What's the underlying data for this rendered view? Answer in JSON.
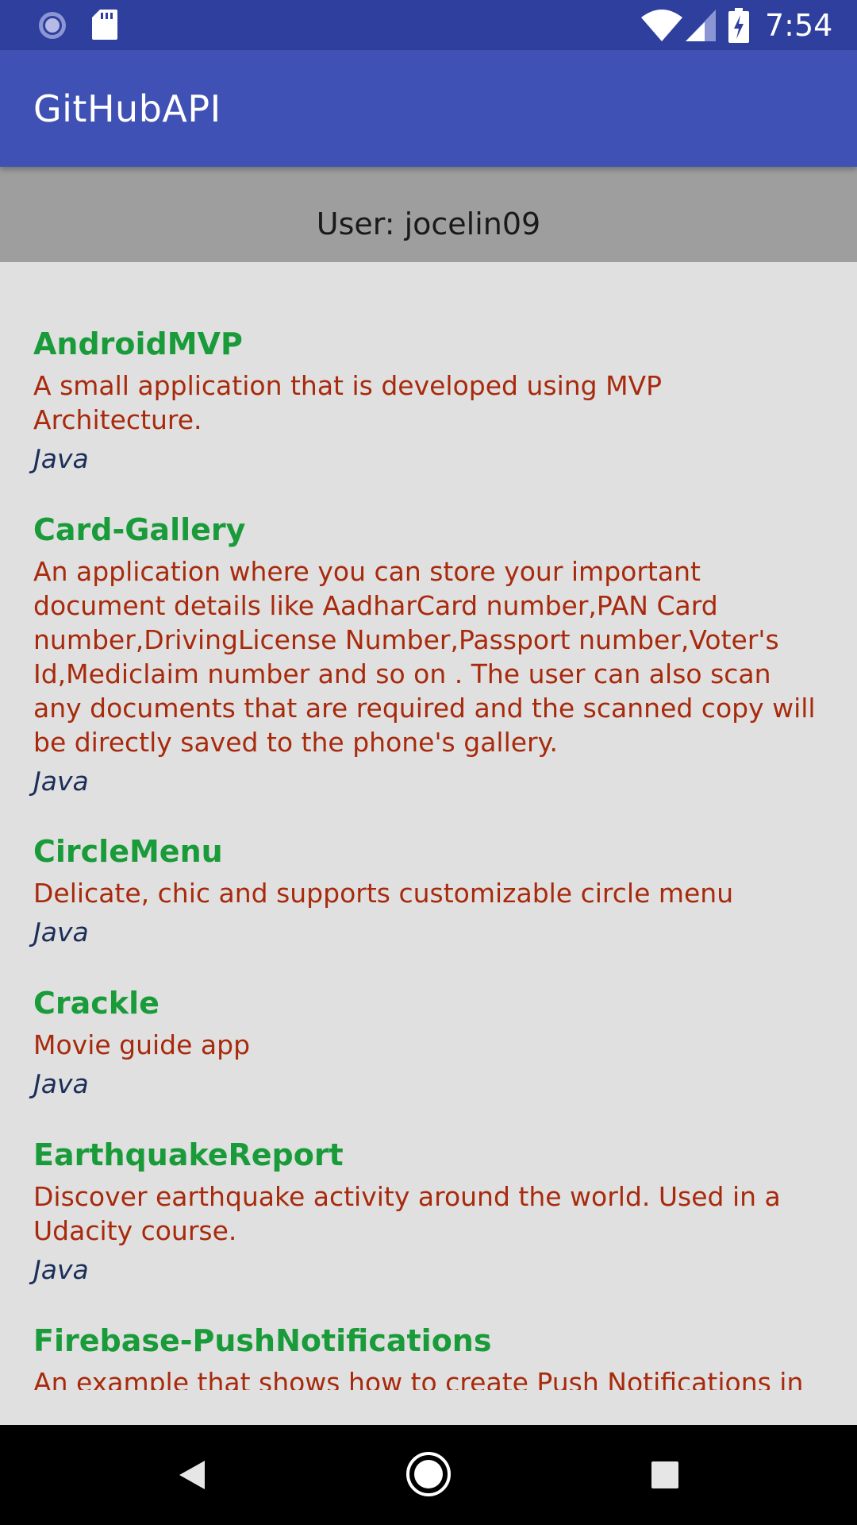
{
  "status_bar": {
    "time": "7:54",
    "icons": [
      "sync-icon",
      "sd-card-icon",
      "wifi-icon",
      "signal-icon",
      "battery-charging-icon"
    ]
  },
  "app_bar": {
    "title": "GitHubAPI"
  },
  "user_header": {
    "label": "User: jocelin09"
  },
  "repos": [
    {
      "name": "AndroidMVP",
      "description": "A small application that is developed using MVP Architecture.",
      "language": "Java"
    },
    {
      "name": "Card-Gallery",
      "description": "An application where you can store your important document details like AadharCard number,PAN Card number,DrivingLicense Number,Passport number,Voter's Id,Mediclaim number and so on . The user can also scan any documents that are required and the scanned copy will be directly saved to the phone's gallery.",
      "language": "Java"
    },
    {
      "name": "CircleMenu",
      "description": "Delicate, chic and supports customizable circle menu",
      "language": "Java"
    },
    {
      "name": "Crackle",
      "description": "Movie guide app",
      "language": "Java"
    },
    {
      "name": "EarthquakeReport",
      "description": "Discover earthquake activity around the world. Used in a Udacity course.",
      "language": "Java"
    },
    {
      "name": "Firebase-PushNotifications",
      "description": "An example that shows how to create Push Notifications in",
      "language": ""
    }
  ],
  "nav_bar": {
    "icons": [
      "back-icon",
      "home-icon",
      "recents-icon"
    ]
  },
  "colors": {
    "status_bar": "#2f3f9e",
    "app_bar": "#3f51b5",
    "user_header": "#9e9e9e",
    "list_background": "#e0e0e0",
    "repo_name": "#1a9b3a",
    "repo_description": "#a82a0c",
    "repo_language": "#1c2f5a"
  }
}
